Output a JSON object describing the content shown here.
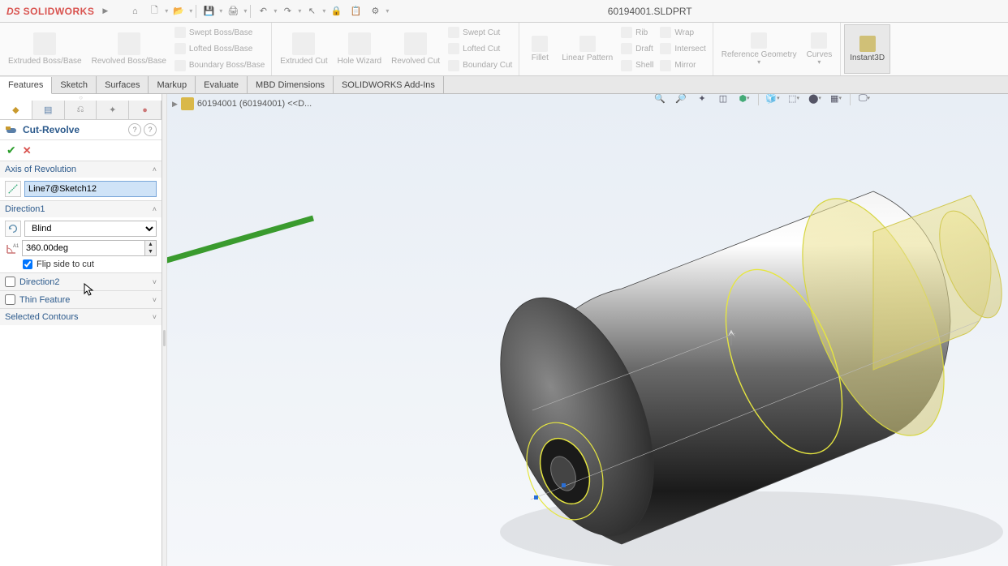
{
  "app": {
    "brand_prefix": "DS",
    "brand": "SOLIDWORKS",
    "doc_title": "60194001.SLDPRT"
  },
  "qat": {
    "home": "⌂",
    "new": "🗋",
    "open": "📂",
    "save": "💾",
    "print": "🖨",
    "undo": "↶",
    "redo": "↷",
    "select": "↖",
    "rebuild": "⟳",
    "options": "⚙"
  },
  "ribbon": {
    "groups": [
      {
        "large": [
          {
            "label": "Extruded Boss/Base"
          },
          {
            "label": "Revolved Boss/Base"
          }
        ],
        "stack": [
          {
            "label": "Swept Boss/Base"
          },
          {
            "label": "Lofted Boss/Base"
          },
          {
            "label": "Boundary Boss/Base"
          }
        ]
      },
      {
        "large": [
          {
            "label": "Extruded Cut"
          },
          {
            "label": "Hole Wizard"
          },
          {
            "label": "Revolved Cut"
          }
        ],
        "stack": [
          {
            "label": "Swept Cut"
          },
          {
            "label": "Lofted Cut"
          },
          {
            "label": "Boundary Cut"
          }
        ]
      },
      {
        "large": [
          {
            "label": "Fillet"
          },
          {
            "label": "Linear Pattern"
          }
        ],
        "stack": [
          {
            "label": "Rib"
          },
          {
            "label": "Draft"
          },
          {
            "label": "Shell"
          }
        ],
        "stack2": [
          {
            "label": "Wrap"
          },
          {
            "label": "Intersect"
          },
          {
            "label": "Mirror"
          }
        ]
      },
      {
        "large": [
          {
            "label": "Reference Geometry"
          },
          {
            "label": "Curves"
          }
        ]
      },
      {
        "large": [
          {
            "label": "Instant3D",
            "active": true
          }
        ]
      }
    ]
  },
  "tabs": [
    {
      "label": "Features",
      "active": true
    },
    {
      "label": "Sketch"
    },
    {
      "label": "Surfaces"
    },
    {
      "label": "Markup"
    },
    {
      "label": "Evaluate"
    },
    {
      "label": "MBD Dimensions"
    },
    {
      "label": "SOLIDWORKS Add-Ins"
    }
  ],
  "panel": {
    "feature_name": "Cut-Revolve",
    "sections": {
      "axis": {
        "title": "Axis of Revolution",
        "value": "Line7@Sketch12"
      },
      "dir1": {
        "title": "Direction1",
        "end_condition": "Blind",
        "angle": "360.00deg",
        "flip_label": "Flip side to cut",
        "flip_checked": true
      },
      "dir2": {
        "title": "Direction2",
        "checked": false
      },
      "thin": {
        "title": "Thin Feature",
        "checked": false
      },
      "contours": {
        "title": "Selected Contours"
      }
    }
  },
  "breadcrumb": {
    "text": "60194001 (60194001) <<D..."
  },
  "hud_icons": [
    "🔍",
    "🔎",
    "✦",
    "📦",
    "🧊",
    "🧊",
    "⬚",
    "⬚",
    "📺"
  ]
}
